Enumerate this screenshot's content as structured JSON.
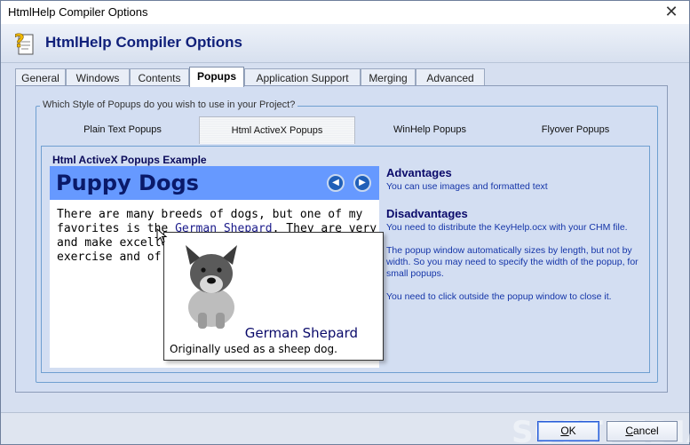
{
  "window": {
    "title": "HtmlHelp Compiler Options",
    "close_glyph": "✕"
  },
  "header": {
    "title": "HtmlHelp Compiler Options",
    "icon": "help-page-icon"
  },
  "tabs": [
    {
      "label": "General"
    },
    {
      "label": "Windows"
    },
    {
      "label": "Contents"
    },
    {
      "label": "Popups"
    },
    {
      "label": "Application Support"
    },
    {
      "label": "Merging"
    },
    {
      "label": "Advanced"
    }
  ],
  "active_tab": "Popups",
  "popup_style": {
    "group_label": "Which Style of Popups do you wish to use in your Project?",
    "options": [
      {
        "label": "Plain Text Popups"
      },
      {
        "label": "Html ActiveX Popups"
      },
      {
        "label": "WinHelp Popups"
      },
      {
        "label": "Flyover Popups"
      }
    ],
    "selected": "Html ActiveX Popups"
  },
  "example": {
    "title": "Html ActiveX Popups Example",
    "page_title": "Puppy Dogs",
    "body_lines": [
      {
        "before": "There are many breeds of dogs, but one of my",
        "link": "",
        "after": ""
      },
      {
        "before": "favorites is the ",
        "link": "German Shepard",
        "after": ". They are very loyal"
      },
      {
        "before": "and make excellent",
        "link": "",
        "after": ""
      },
      {
        "before": "exercise and of c",
        "link": "",
        "after": ""
      }
    ],
    "popup": {
      "heading": "German Shepard",
      "caption": "Originally used as a sheep dog."
    },
    "nav": {
      "back": "◀",
      "forward": "▶"
    }
  },
  "info": {
    "advantages_heading": "Advantages",
    "advantages_text": "You can use images and formatted text",
    "disadvantages_heading": "Disadvantages",
    "disadvantages": [
      "You need to distribute the KeyHelp.ocx with your CHM file.",
      "The popup window automatically sizes by length, but not by width. So you may need to specify the width of the popup, for small popups.",
      "You need to click outside the popup window to close it."
    ]
  },
  "buttons": {
    "ok_u": "O",
    "ok_rest": "K",
    "cancel_u": "C",
    "cancel_rest": "ancel"
  },
  "watermark": "SOFTPEDIA"
}
